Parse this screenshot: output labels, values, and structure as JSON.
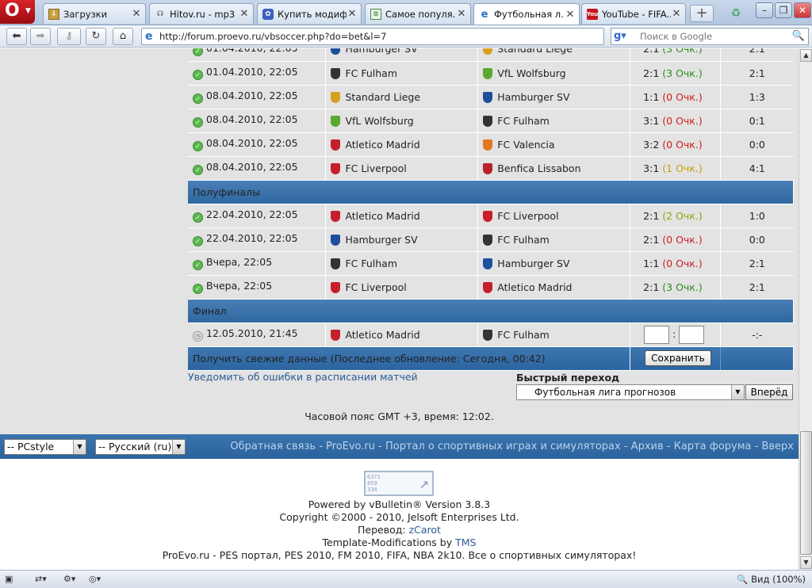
{
  "browser": {
    "menu_label": "O",
    "tabs": [
      {
        "label": "Загрузки",
        "icon": "download-icon",
        "active": false
      },
      {
        "label": "Hitov.ru - mp3 ...",
        "icon": "headphones-icon",
        "active": false
      },
      {
        "label": "Купить модиф...",
        "icon": "shop-icon",
        "active": false
      },
      {
        "label": "Самое популя...",
        "icon": "page-icon",
        "active": false
      },
      {
        "label": "Футбольная л...",
        "icon": "ie-page-icon",
        "active": true
      },
      {
        "label": "YouTube - FIFA...",
        "icon": "youtube-icon",
        "active": false
      }
    ],
    "url": "http://forum.proevo.ru/vbsoccer.php?do=bet&l=7",
    "search_placeholder": "Поиск в Google",
    "zoom": "Вид (100%)"
  },
  "matches_before": [
    {
      "date": "01.04.2010, 22:05",
      "home": "Hamburger SV",
      "away": "Standard Liege",
      "bet": "2:1",
      "points": "(3 Очк.)",
      "pts": 3,
      "result": "2:1",
      "status": "done"
    },
    {
      "date": "01.04.2010, 22:05",
      "home": "FC Fulham",
      "away": "VfL Wolfsburg",
      "bet": "2:1",
      "points": "(3 Очк.)",
      "pts": 3,
      "result": "2:1",
      "status": "done"
    },
    {
      "date": "08.04.2010, 22:05",
      "home": "Standard Liege",
      "away": "Hamburger SV",
      "bet": "1:1",
      "points": "(0 Очк.)",
      "pts": 0,
      "result": "1:3",
      "status": "done"
    },
    {
      "date": "08.04.2010, 22:05",
      "home": "VfL Wolfsburg",
      "away": "FC Fulham",
      "bet": "3:1",
      "points": "(0 Очк.)",
      "pts": 0,
      "result": "0:1",
      "status": "done"
    },
    {
      "date": "08.04.2010, 22:05",
      "home": "Atletico Madrid",
      "away": "FC Valencia",
      "bet": "3:2",
      "points": "(0 Очк.)",
      "pts": 0,
      "result": "0:0",
      "status": "done"
    },
    {
      "date": "08.04.2010, 22:05",
      "home": "FC Liverpool",
      "away": "Benfica Lissabon",
      "bet": "3:1",
      "points": "(1 Очк.)",
      "pts": 1,
      "result": "4:1",
      "status": "done"
    }
  ],
  "semifinal_title": "Полуфиналы",
  "matches_semis": [
    {
      "date": "22.04.2010, 22:05",
      "home": "Atletico Madrid",
      "away": "FC Liverpool",
      "bet": "2:1",
      "points": "(2 Очк.)",
      "pts": 2,
      "result": "1:0",
      "status": "done"
    },
    {
      "date": "22.04.2010, 22:05",
      "home": "Hamburger SV",
      "away": "FC Fulham",
      "bet": "2:1",
      "points": "(0 Очк.)",
      "pts": 0,
      "result": "0:0",
      "status": "done"
    },
    {
      "date": "Вчера, 22:05",
      "home": "FC Fulham",
      "away": "Hamburger SV",
      "bet": "1:1",
      "points": "(0 Очк.)",
      "pts": 0,
      "result": "2:1",
      "status": "done"
    },
    {
      "date": "Вчера, 22:05",
      "home": "FC Liverpool",
      "away": "Atletico Madrid",
      "bet": "2:1",
      "points": "(3 Очк.)",
      "pts": 3,
      "result": "2:1",
      "status": "done"
    }
  ],
  "final_title": "Финал",
  "final_match": {
    "date": "12.05.2010, 21:45",
    "home": "Atletico Madrid",
    "away": "FC Fulham",
    "separator": ":",
    "result": "-:-",
    "status": "pending"
  },
  "refresh_text": "Получить свежие данные (Последнее обновление: Сегодня, 00:42)",
  "save_label": "Сохранить",
  "report_link": "Уведомить об ошибки в расписании матчей",
  "quick_jump": {
    "label": "Быстрый переход",
    "selected": "Футбольная лига прогнозов",
    "go": "Вперёд"
  },
  "timezone": "Часовой пояс GMT +3, время: 12:02.",
  "style_select": "-- PCstyle",
  "lang_select": "-- Русский (ru)",
  "footer_links": [
    "Обратная связь",
    "ProEvo.ru - Портал о спортивных играх и симуляторах",
    "Архив",
    "Карта форума",
    "Вверх"
  ],
  "footer_sep": " - ",
  "footer": {
    "logo_digits": "6371\n859\n334",
    "powered": "Powered by vBulletin® Version 3.8.3",
    "copyright": "Copyright ©2000 - 2010, Jelsoft Enterprises Ltd.",
    "translation_prefix": "Перевод: ",
    "translation_link": "zCarot",
    "template_prefix": "Template-Modifications by ",
    "template_link": "TMS",
    "site": "ProEvo.ru - PES портал, PES 2010, FM 2010, FIFA, NBA 2k10. Все о спортивных симуляторах!"
  },
  "crest_colors": {
    "Hamburger SV": "#1d4f9c",
    "Standard Liege": "#d8a020",
    "FC Fulham": "#333333",
    "VfL Wolfsburg": "#5aa832",
    "Atletico Madrid": "#c4202c",
    "FC Valencia": "#e07820",
    "FC Liverpool": "#c81e2a",
    "Benfica Lissabon": "#b8222a"
  }
}
